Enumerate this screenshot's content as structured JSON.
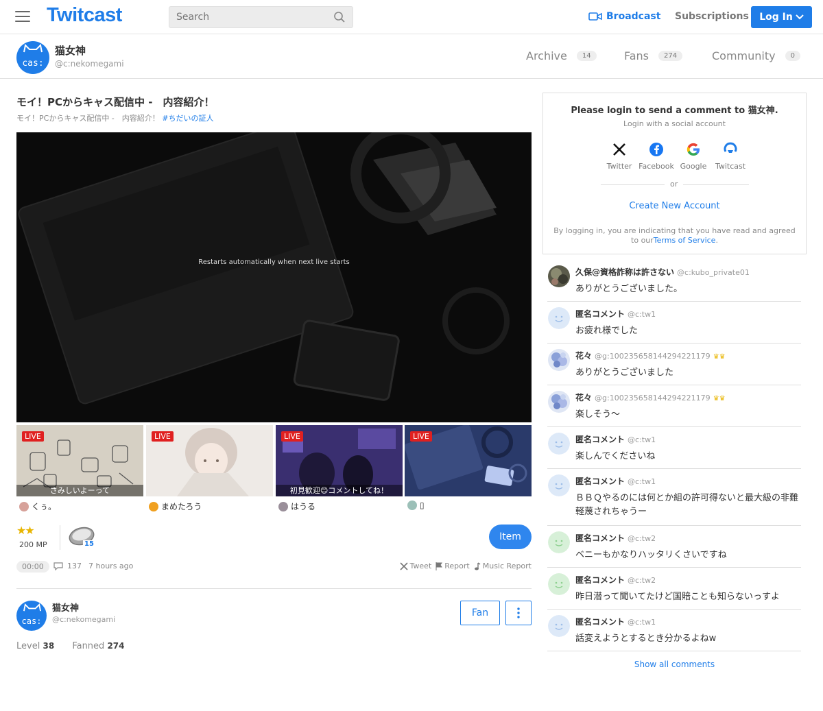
{
  "header": {
    "logo": "Twitcast",
    "search_placeholder": "Search",
    "broadcast_label": "Broadcast",
    "subscriptions_label": "Subscriptions",
    "login_label": "Log In"
  },
  "profile": {
    "name": "猫女神",
    "id": "@c:nekomegami",
    "avatar_text": "cas:",
    "tabs": [
      {
        "label": "Archive",
        "count": "14"
      },
      {
        "label": "Fans",
        "count": "274"
      },
      {
        "label": "Community",
        "count": "0"
      }
    ]
  },
  "stream": {
    "title": "モイ！PCからキャス配信中 -　内容紹介！",
    "subtitle": "モイ！PCからキャス配信中 -　内容紹介！",
    "tag": "#ちだいの証人",
    "player_message": "Restarts automatically when next live starts",
    "stars": "★★",
    "mp": "200 MP",
    "coin_count": "15",
    "item_label": "Item",
    "timer": "00:00",
    "comment_count": "137",
    "time_ago": "7 hours ago",
    "tweet_label": "Tweet",
    "report_label": "Report",
    "music_report_label": "Music Report"
  },
  "thumbs": [
    {
      "live": "LIVE",
      "caption": "さみしいよーって",
      "user": "くぅ。",
      "bg": "#d9d4c8",
      "uav": "#d7a29a"
    },
    {
      "live": "LIVE",
      "caption": "",
      "user": "まめたろう",
      "bg": "#ece6e0",
      "uav": "#f0a020"
    },
    {
      "live": "LIVE",
      "caption": "初見歓迎😊コメントしてね！",
      "user": "はうる",
      "bg": "#3a2f6e",
      "uav": "#9a8f9a"
    },
    {
      "live": "LIVE",
      "caption": "",
      "user": "▯",
      "bg": "#2a3a6a",
      "uav": "#9cc0b8"
    }
  ],
  "owner": {
    "name": "猫女神",
    "id": "@c:nekomegami",
    "fan_label": "Fan",
    "level_label": "Level",
    "level_value": "38",
    "fanned_label": "Fanned",
    "fanned_value": "274"
  },
  "login_box": {
    "title": "Please login to send a comment to 猫女神.",
    "subtitle": "Login with a social account",
    "socials": [
      "Twitter",
      "Facebook",
      "Google",
      "Twitcast"
    ],
    "or": "or",
    "create": "Create New Account",
    "terms_prefix": "By logging in, you are indicating that you have read and agreed to our",
    "terms_link": "Terms of Service",
    "terms_suffix": "."
  },
  "comments": [
    {
      "name": "久保@資格詐称は許さない",
      "id": "@c:kubo_private01",
      "text": "ありがとうございました。",
      "avatar": "photo",
      "crown": ""
    },
    {
      "name": "匿名コメント",
      "id": "@c:tw1",
      "text": "お疲れ様でした",
      "avatar": "anon-blue",
      "crown": ""
    },
    {
      "name": "花々",
      "id": "@g:100235658144294221179",
      "text": "ありがとうございました",
      "avatar": "flower",
      "crown": "♛♛"
    },
    {
      "name": "花々",
      "id": "@g:100235658144294221179",
      "text": "楽しそう〜",
      "avatar": "flower",
      "crown": "♛♛"
    },
    {
      "name": "匿名コメント",
      "id": "@c:tw1",
      "text": "楽しんでくださいね",
      "avatar": "anon-blue",
      "crown": ""
    },
    {
      "name": "匿名コメント",
      "id": "@c:tw1",
      "text": "ＢＢＱやるのには何とか組の許可得ないと最大級の非難軽蔑されちゃうー",
      "avatar": "anon-blue",
      "crown": ""
    },
    {
      "name": "匿名コメント",
      "id": "@c:tw2",
      "text": "ベニーもかなりハッタリくさいですね",
      "avatar": "anon-green",
      "crown": ""
    },
    {
      "name": "匿名コメント",
      "id": "@c:tw2",
      "text": "昨日潜って聞いてたけど国賠ことも知らないっすよ",
      "avatar": "anon-green",
      "crown": ""
    },
    {
      "name": "匿名コメント",
      "id": "@c:tw1",
      "text": "話変えようとするとき分かるよねw",
      "avatar": "anon-blue",
      "crown": ""
    }
  ],
  "show_all": "Show all comments",
  "colors": {
    "brand": "#1f7de8",
    "live": "#e02020",
    "star": "#e8b500"
  }
}
